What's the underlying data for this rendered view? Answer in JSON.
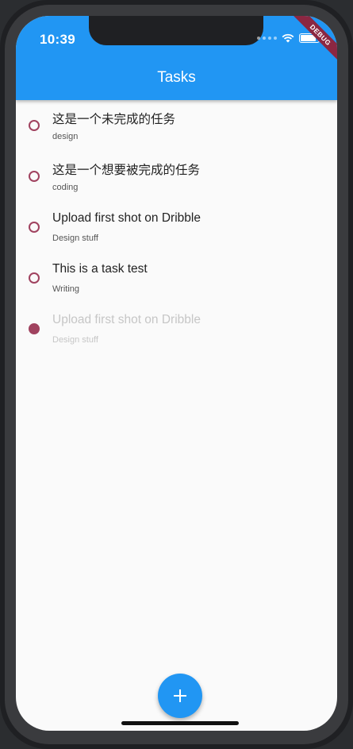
{
  "status_bar": {
    "time": "10:39"
  },
  "debug_banner": {
    "label": "DEBUG"
  },
  "app_bar": {
    "title": "Tasks"
  },
  "tasks": [
    {
      "title": "这是一个未完成的任务",
      "category": "design",
      "completed": false
    },
    {
      "title": "这是一个想要被完成的任务",
      "category": "coding",
      "completed": false
    },
    {
      "title": "Upload first shot on Dribble",
      "category": "Design stuff",
      "completed": false
    },
    {
      "title": "This is a task test",
      "category": "Writing",
      "completed": false
    },
    {
      "title": "Upload first shot on Dribble",
      "category": "Design stuff",
      "completed": true
    }
  ],
  "fab": {
    "icon": "plus-icon"
  },
  "colors": {
    "primary": "#2196f3",
    "accent": "#a0425f",
    "background": "#fafafa"
  }
}
